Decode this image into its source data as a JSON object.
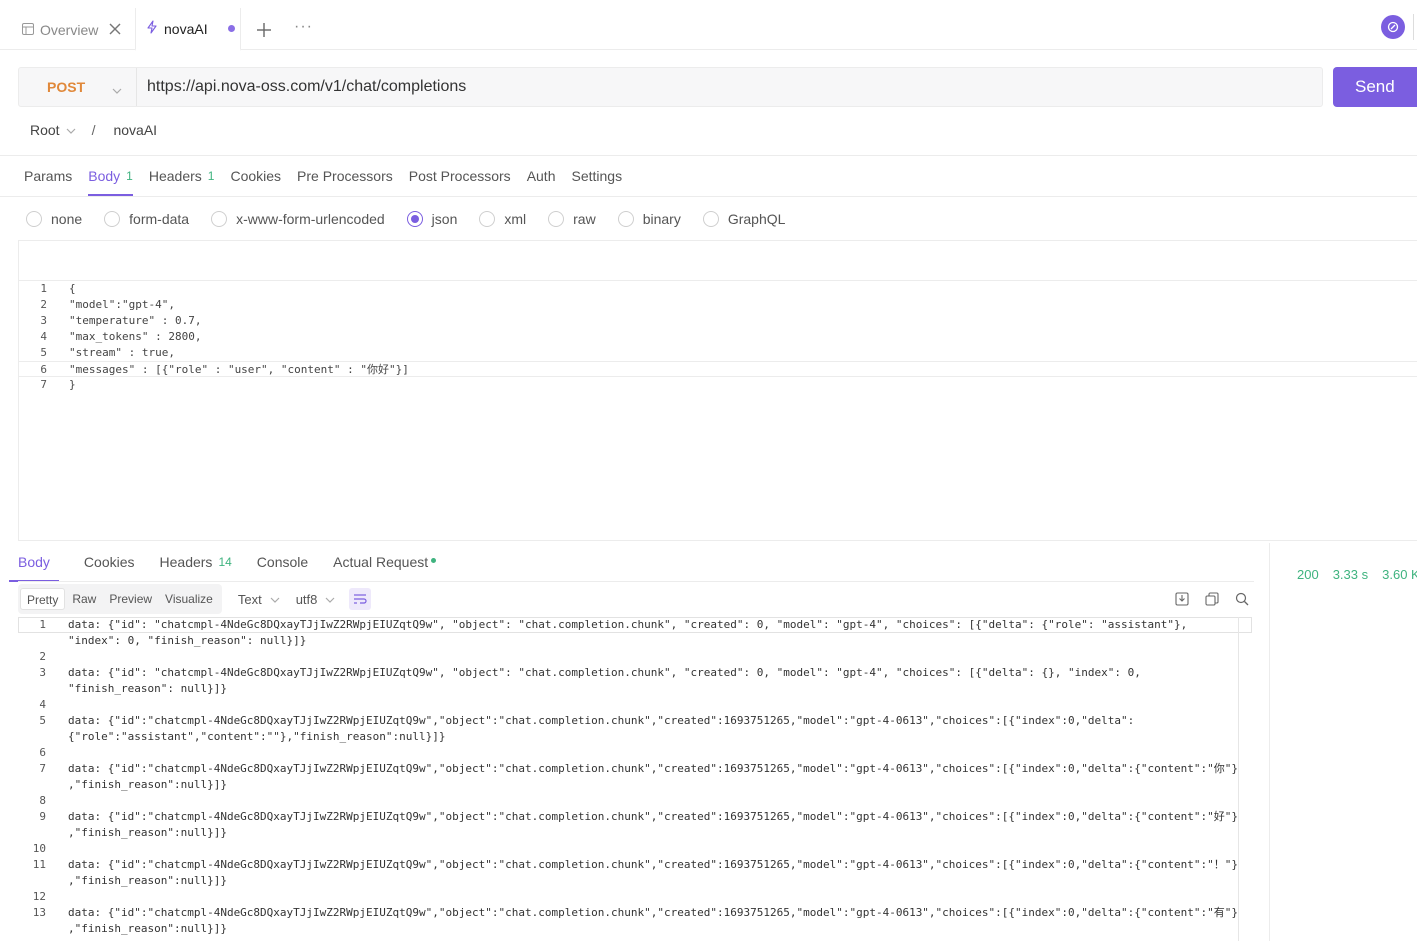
{
  "tabs": {
    "overview_label": "Overview",
    "active_label": "novaAI",
    "more_label": "···"
  },
  "request": {
    "method": "POST",
    "url": "https://api.nova-oss.com/v1/chat/completions",
    "send_label": "Send"
  },
  "breadcrumb": {
    "root": "Root",
    "separator": "/",
    "name": "novaAI"
  },
  "request_tabs": [
    {
      "label": "Params",
      "badge": ""
    },
    {
      "label": "Body",
      "badge": "1"
    },
    {
      "label": "Headers",
      "badge": "1"
    },
    {
      "label": "Cookies",
      "badge": ""
    },
    {
      "label": "Pre Processors",
      "badge": ""
    },
    {
      "label": "Post Processors",
      "badge": ""
    },
    {
      "label": "Auth",
      "badge": ""
    },
    {
      "label": "Settings",
      "badge": ""
    }
  ],
  "body_types": [
    "none",
    "form-data",
    "x-www-form-urlencoded",
    "json",
    "xml",
    "raw",
    "binary",
    "GraphQL"
  ],
  "body_type_selected": "json",
  "request_body": [
    "{",
    "\"model\":\"gpt-4\",",
    "\"temperature\" : 0.7,",
    "\"max_tokens\" : 2800,",
    "\"stream\" : true,",
    "\"messages\" : [{\"role\" : \"user\", \"content\" : \"你好\"}]",
    "}"
  ],
  "response_tabs": [
    {
      "label": "Body",
      "badge": ""
    },
    {
      "label": "Cookies",
      "badge": ""
    },
    {
      "label": "Headers",
      "badge": "14"
    },
    {
      "label": "Console",
      "badge": ""
    },
    {
      "label": "Actual Request",
      "badge": ""
    }
  ],
  "response_status": {
    "code": "200",
    "time": "3.33 s",
    "size": "3.60 K"
  },
  "response_view": {
    "modes": [
      "Pretty",
      "Raw",
      "Preview",
      "Visualize"
    ],
    "selected": "Pretty",
    "format": "Text",
    "encoding": "utf8"
  },
  "response_lines": [
    {
      "n": "1",
      "a": "data: {\"id\": \"chatcmpl-4NdeGc8DQxayTJjIwZ2RWpjEIUZqtQ9w\", \"object\": \"chat.completion.chunk\", \"created\": 0, \"model\": \"gpt-4\", \"choices\": [{\"delta\": {\"role\": \"assistant\"},",
      "b": "\"index\": 0, \"finish_reason\": null}]}"
    },
    {
      "n": "2",
      "a": "",
      "b": ""
    },
    {
      "n": "3",
      "a": "data: {\"id\": \"chatcmpl-4NdeGc8DQxayTJjIwZ2RWpjEIUZqtQ9w\", \"object\": \"chat.completion.chunk\", \"created\": 0, \"model\": \"gpt-4\", \"choices\": [{\"delta\": {}, \"index\": 0,",
      "b": "\"finish_reason\": null}]}"
    },
    {
      "n": "4",
      "a": "",
      "b": ""
    },
    {
      "n": "5",
      "a": "data: {\"id\":\"chatcmpl-4NdeGc8DQxayTJjIwZ2RWpjEIUZqtQ9w\",\"object\":\"chat.completion.chunk\",\"created\":1693751265,\"model\":\"gpt-4-0613\",\"choices\":[{\"index\":0,\"delta\":",
      "b": "{\"role\":\"assistant\",\"content\":\"\"},\"finish_reason\":null}]}"
    },
    {
      "n": "6",
      "a": "",
      "b": ""
    },
    {
      "n": "7",
      "a": "data: {\"id\":\"chatcmpl-4NdeGc8DQxayTJjIwZ2RWpjEIUZqtQ9w\",\"object\":\"chat.completion.chunk\",\"created\":1693751265,\"model\":\"gpt-4-0613\",\"choices\":[{\"index\":0,\"delta\":{\"content\":\"你\"}",
      "b": ",\"finish_reason\":null}]}"
    },
    {
      "n": "8",
      "a": "",
      "b": ""
    },
    {
      "n": "9",
      "a": "data: {\"id\":\"chatcmpl-4NdeGc8DQxayTJjIwZ2RWpjEIUZqtQ9w\",\"object\":\"chat.completion.chunk\",\"created\":1693751265,\"model\":\"gpt-4-0613\",\"choices\":[{\"index\":0,\"delta\":{\"content\":\"好\"}",
      "b": ",\"finish_reason\":null}]}"
    },
    {
      "n": "10",
      "a": "",
      "b": ""
    },
    {
      "n": "11",
      "a": "data: {\"id\":\"chatcmpl-4NdeGc8DQxayTJjIwZ2RWpjEIUZqtQ9w\",\"object\":\"chat.completion.chunk\",\"created\":1693751265,\"model\":\"gpt-4-0613\",\"choices\":[{\"index\":0,\"delta\":{\"content\":\"！\"}",
      "b": ",\"finish_reason\":null}]}"
    },
    {
      "n": "12",
      "a": "",
      "b": ""
    },
    {
      "n": "13",
      "a": "data: {\"id\":\"chatcmpl-4NdeGc8DQxayTJjIwZ2RWpjEIUZqtQ9w\",\"object\":\"chat.completion.chunk\",\"created\":1693751265,\"model\":\"gpt-4-0613\",\"choices\":[{\"index\":0,\"delta\":{\"content\":\"有\"}",
      "b": ",\"finish_reason\":null}]}"
    }
  ],
  "colors": {
    "accent": "#7b5ee0",
    "method": "#e0883a",
    "success": "#3fb37f"
  },
  "icons": {
    "overview": "layout-icon",
    "active_tab": "lightning-icon",
    "close": "close-icon",
    "add": "plus-icon",
    "sync": "sync-icon",
    "method_dropdown": "chevron-down-icon",
    "wrap": "wrap-lines-icon",
    "save": "save-icon",
    "copy": "copy-icon",
    "search": "search-icon"
  }
}
